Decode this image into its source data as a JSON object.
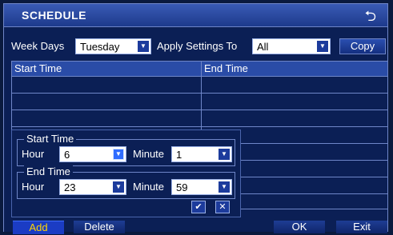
{
  "window": {
    "title": "SCHEDULE"
  },
  "controls": {
    "week_days_label": "Week Days",
    "week_day_value": "Tuesday",
    "apply_label": "Apply Settings To",
    "apply_value": "All",
    "copy_label": "Copy"
  },
  "table": {
    "columns": [
      "Start Time",
      "End Time"
    ],
    "rows": []
  },
  "popup": {
    "start": {
      "legend": "Start Time",
      "hour_label": "Hour",
      "hour_value": "6",
      "minute_label": "Minute",
      "minute_value": "1"
    },
    "end": {
      "legend": "End Time",
      "hour_label": "Hour",
      "hour_value": "23",
      "minute_label": "Minute",
      "minute_value": "59"
    },
    "confirm_symbol": "✔",
    "cancel_symbol": "✕"
  },
  "footer": {
    "add_label": "Add",
    "delete_label": "Delete",
    "ok_label": "OK",
    "exit_label": "Exit"
  },
  "colors": {
    "accent": "#2f6cff",
    "panel": "#0b1f55",
    "border": "#6f86c8"
  }
}
